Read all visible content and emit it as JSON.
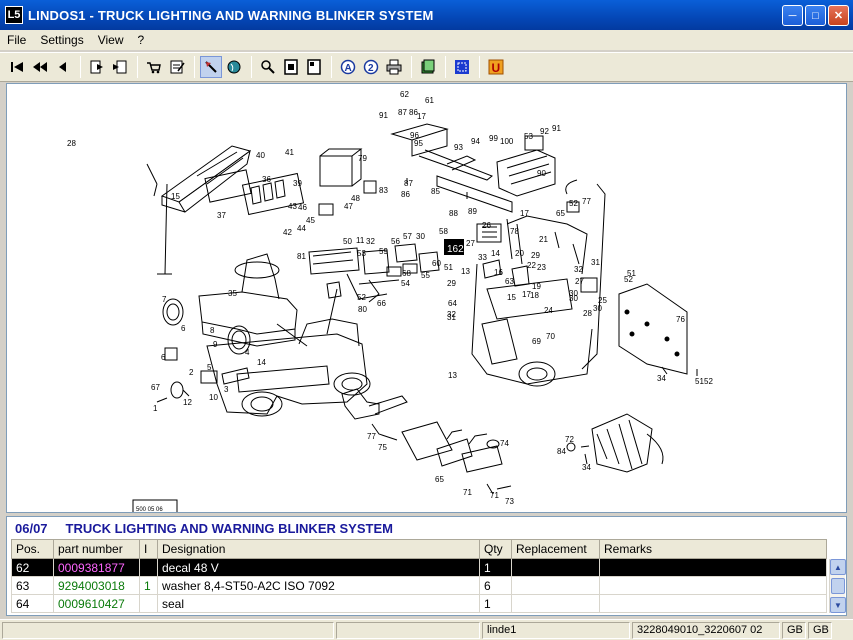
{
  "window": {
    "title": "LINDOS1 - TRUCK LIGHTING AND WARNING BLINKER SYSTEM",
    "icon_label": "L5"
  },
  "menu": [
    "File",
    "Settings",
    "View",
    "?"
  ],
  "toolbar": {
    "buttons": [
      "first-page-icon",
      "prev-fast-icon",
      "prev-icon",
      "export-icon",
      "import-icon",
      "cart-icon",
      "order-list-icon",
      "pointer-tool-icon",
      "globe-icon",
      "zoom-icon",
      "page-icon",
      "page-alt-icon",
      "text-search-icon",
      "number-search-icon",
      "print-icon",
      "book-icon",
      "grid-icon",
      "user-icon"
    ]
  },
  "drawing": {
    "labels": [
      "62",
      "61",
      "91",
      "87",
      "86",
      "17",
      "96",
      "95",
      "93",
      "94",
      "99",
      "100",
      "53",
      "92",
      "91",
      "79",
      "90",
      "40",
      "41",
      "36",
      "39",
      "87",
      "86",
      "15",
      "37",
      "46",
      "47",
      "48",
      "83",
      "85",
      "88",
      "89",
      "44",
      "43",
      "42",
      "45",
      "17",
      "65",
      "52",
      "77",
      "27",
      "26",
      "78",
      "21",
      "50",
      "11",
      "32",
      "56",
      "57",
      "30",
      "58",
      "59",
      "53",
      "68",
      "33",
      "81",
      "63",
      "29",
      "23",
      "22",
      "20",
      "14",
      "16",
      "13",
      "19",
      "18",
      "17",
      "15",
      "32",
      "31",
      "51",
      "52",
      "24",
      "27",
      "25",
      "28",
      "30",
      "29",
      "30",
      "66",
      "52",
      "80",
      "64",
      "32",
      "31",
      "70",
      "69",
      "76",
      "35",
      "7",
      "6",
      "8",
      "9",
      "4",
      "6",
      "67",
      "12",
      "10",
      "2",
      "3",
      "14",
      "5",
      "1",
      "13",
      "34",
      "51",
      "52",
      "77",
      "75",
      "74",
      "65",
      "71",
      "71",
      "73",
      "72",
      "84",
      "34",
      "51",
      "55",
      "60",
      "54",
      "30",
      "28"
    ],
    "callout": "162",
    "stamp": "500 05 06"
  },
  "section": {
    "code": "06/07",
    "title": "TRUCK LIGHTING AND WARNING BLINKER SYSTEM",
    "columns": [
      "Pos.",
      "part number",
      "I",
      "Designation",
      "Qty",
      "Replacement",
      "Remarks"
    ],
    "rows": [
      {
        "pos": "62",
        "part": "0009381877",
        "i": "",
        "designation": "decal 48 V",
        "qty": "1",
        "replacement": "",
        "remarks": ""
      },
      {
        "pos": "63",
        "part": "9294003018",
        "i": "1",
        "designation": "washer 8,4-ST50-A2C  ISO 7092",
        "qty": "6",
        "replacement": "",
        "remarks": ""
      },
      {
        "pos": "64",
        "part": "0009610427",
        "i": "",
        "designation": "seal",
        "qty": "1",
        "replacement": "",
        "remarks": ""
      }
    ]
  },
  "status": {
    "user": "linde1",
    "doc": "3228049010_3220607 02",
    "lang1": "GB",
    "lang2": "GB"
  }
}
